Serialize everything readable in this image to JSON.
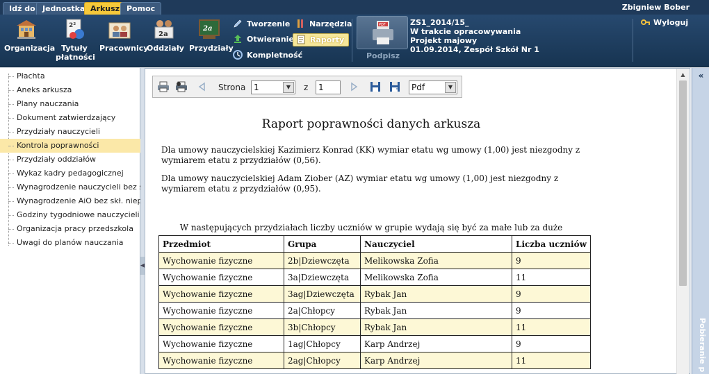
{
  "menu": {
    "tabs": [
      {
        "label": "Idź do",
        "active": false
      },
      {
        "label": "Jednostka",
        "active": false
      },
      {
        "label": "Arkusz",
        "active": true
      },
      {
        "label": "Pomoc",
        "active": false
      }
    ],
    "user": "Zbigniew Bober"
  },
  "toolbar": {
    "big_buttons": [
      {
        "label": "Organizacja",
        "icon": "organization-icon"
      },
      {
        "label": "Tytuły\npłatności",
        "icon": "payment-titles-icon"
      },
      {
        "label": "Pracownicy",
        "icon": "employees-icon"
      },
      {
        "label": "Oddziały",
        "icon": "classes-icon"
      },
      {
        "label": "Przydziały",
        "icon": "assignments-icon"
      }
    ],
    "small_buttons": {
      "tworzenie": "Tworzenie",
      "otwieranie": "Otwieranie",
      "kompletnosc": "Kompletność",
      "narzedzia": "Narzędzia",
      "raporty": "Raporty"
    },
    "podpisz": "Podpisz",
    "doc_info": {
      "line1": "ZS1_2014/15_",
      "line2": "W trakcie opracowywania",
      "line3": "Projekt majowy",
      "line4": "01.09.2014, Zespół Szkół Nr 1"
    },
    "logout": "Wyloguj"
  },
  "sidebar": {
    "items": [
      {
        "label": "Płachta",
        "selected": false
      },
      {
        "label": "Aneks arkusza",
        "selected": false
      },
      {
        "label": "Plany nauczania",
        "selected": false
      },
      {
        "label": "Dokument zatwierdzający",
        "selected": false
      },
      {
        "label": "Przydziały nauczycieli",
        "selected": false
      },
      {
        "label": "Kontrola poprawności",
        "selected": true
      },
      {
        "label": "Przydziały oddziałów",
        "selected": false
      },
      {
        "label": "Wykaz kadry pedagogicznej",
        "selected": false
      },
      {
        "label": "Wynagrodzenie nauczycieli bez skł. niep.",
        "selected": false
      },
      {
        "label": "Wynagrodzenie AiO bez skł. niep.",
        "selected": false
      },
      {
        "label": "Godziny tygodniowe nauczycieli",
        "selected": false
      },
      {
        "label": "Organizacja pracy przedszkola",
        "selected": false
      },
      {
        "label": "Uwagi do planów nauczania",
        "selected": false
      }
    ]
  },
  "report_toolbar": {
    "page_label": "Strona",
    "page_value": "1",
    "of_label": "z",
    "total_pages": "1",
    "format_value": "Pdf"
  },
  "report": {
    "title": "Raport poprawności danych arkusza",
    "messages": [
      "Dla umowy nauczycielskiej Kazimierz Konrad (KK) wymiar etatu wg umowy (1,00) jest niezgodny z wymiarem etatu z przydziałów (0,56).",
      "Dla umowy nauczycielskiej Adam Ziober (AZ) wymiar etatu wg umowy (1,00) jest niezgodny z wymiarem etatu z przydziałów (0,95)."
    ],
    "table_caption": "W następujących przydziałach liczby uczniów w grupie wydają się być za małe lub za duże",
    "table": {
      "headers": [
        "Przedmiot",
        "Grupa",
        "Nauczyciel",
        "Liczba uczniów"
      ],
      "rows": [
        [
          "Wychowanie fizyczne",
          "2b|Dziewczęta",
          "Melikowska Zofia",
          "9"
        ],
        [
          "Wychowanie fizyczne",
          "3a|Dziewczęta",
          "Melikowska Zofia",
          "11"
        ],
        [
          "Wychowanie fizyczne",
          "3ag|Dziewczęta",
          "Rybak Jan",
          "9"
        ],
        [
          "Wychowanie fizyczne",
          "2a|Chłopcy",
          "Rybak Jan",
          "9"
        ],
        [
          "Wychowanie fizyczne",
          "3b|Chłopcy",
          "Rybak Jan",
          "11"
        ],
        [
          "Wychowanie fizyczne",
          "1ag|Chłopcy",
          "Karp Andrzej",
          "9"
        ],
        [
          "Wychowanie fizyczne",
          "2ag|Chłopcy",
          "Karp Andrzej",
          "11"
        ]
      ]
    }
  },
  "right_panel": {
    "label": "Pobieranie p"
  },
  "colors": {
    "menu_bg": "#1f3a5a",
    "active_tab": "#f6c93a",
    "selected_nav": "#fbe8a8",
    "table_odd_row": "#fdf8d6"
  }
}
